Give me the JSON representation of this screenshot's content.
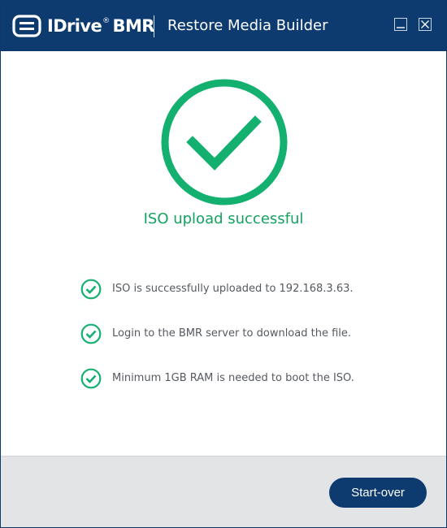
{
  "window": {
    "brand": "IDrive",
    "brand_mark": "®",
    "brand_suffix": "BMR",
    "title": "Restore Media Builder",
    "controls": [
      "minimize-icon",
      "close-icon"
    ]
  },
  "main": {
    "status_icon": "check-circle-icon",
    "heading": "ISO upload successful",
    "items": [
      {
        "icon": "check-circle-icon",
        "text": "ISO is successfully uploaded to 192.168.3.63."
      },
      {
        "icon": "check-circle-icon",
        "text": "Login to the BMR server to download the file."
      },
      {
        "icon": "check-circle-icon",
        "text": "Minimum 1GB RAM is needed to boot the ISO."
      }
    ]
  },
  "footer": {
    "start_over_label": "Start-over"
  },
  "colors": {
    "titlebar": "#0d3b70",
    "success": "#13a35f",
    "footer": "#e3e4e6",
    "button": "#0d3b70"
  }
}
